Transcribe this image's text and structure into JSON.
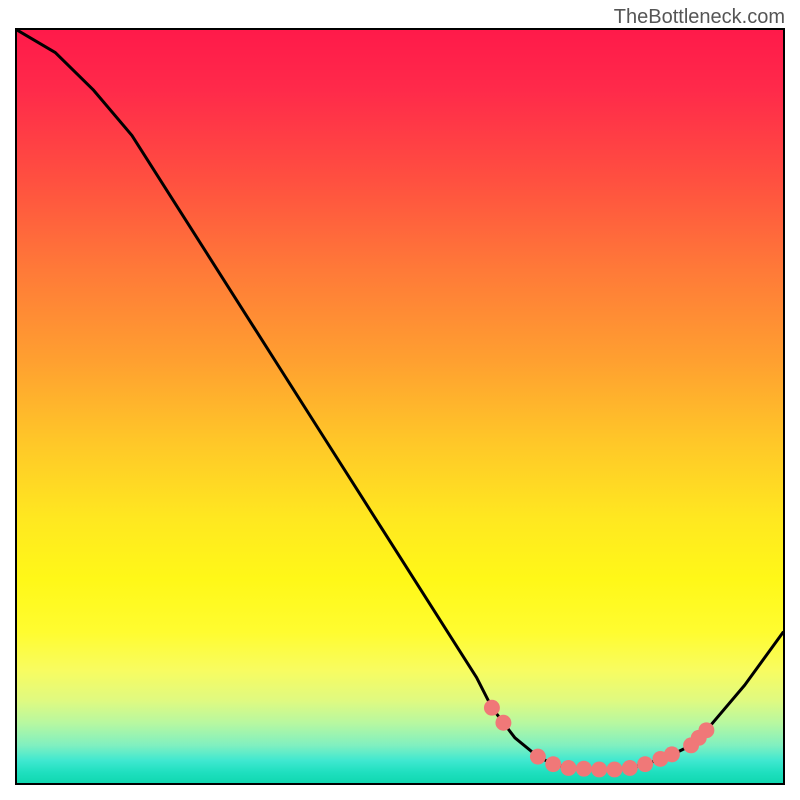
{
  "watermark": "TheBottleneck.com",
  "chart_data": {
    "type": "line",
    "title": "",
    "xlabel": "",
    "ylabel": "",
    "xlim": [
      0,
      100
    ],
    "ylim": [
      0,
      100
    ],
    "series": [
      {
        "name": "bottleneck-curve",
        "x": [
          0,
          5,
          10,
          15,
          20,
          25,
          30,
          35,
          40,
          45,
          50,
          55,
          60,
          62,
          65,
          68,
          70,
          72,
          75,
          78,
          80,
          82,
          85,
          88,
          90,
          95,
          100
        ],
        "y": [
          100,
          97,
          92,
          86,
          78,
          70,
          62,
          54,
          46,
          38,
          30,
          22,
          14,
          10,
          6,
          3.5,
          2.5,
          2,
          1.8,
          1.8,
          2,
          2.5,
          3.5,
          5,
          7,
          13,
          20
        ]
      }
    ],
    "markers": {
      "name": "highlight-dots",
      "color": "#f07878",
      "x": [
        62,
        63.5,
        68,
        70,
        72,
        74,
        76,
        78,
        80,
        82,
        84,
        85.5,
        88,
        89,
        90
      ],
      "y": [
        10,
        8,
        3.5,
        2.5,
        2,
        1.9,
        1.8,
        1.8,
        2,
        2.5,
        3.2,
        3.8,
        5,
        6,
        7
      ]
    }
  }
}
